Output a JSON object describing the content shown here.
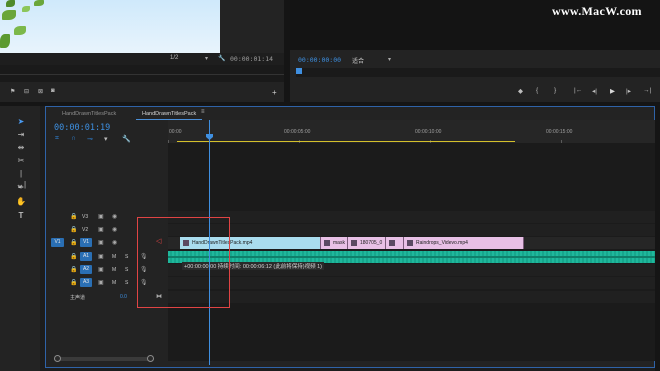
{
  "watermark": "www.MacW.com",
  "source_monitor": {
    "zoom_label": "1/2",
    "timecode": "00:00:01:14"
  },
  "program_monitor": {
    "timecode": "00:00:00:00",
    "fit_label": "适合",
    "transport_icons": [
      "marker-icon",
      "mark-in-icon",
      "mark-out-icon",
      "go-to-in-icon",
      "step-back-icon",
      "play-icon",
      "step-forward-icon",
      "go-to-out-icon"
    ]
  },
  "timeline": {
    "tabs": [
      {
        "label": "HandDrawnTitlesPack"
      },
      {
        "label": "HandDrawnTitlesPack"
      }
    ],
    "playhead_time": "00:00:01:19",
    "ruler_labels": [
      "00:00",
      "00:00:05:00",
      "00:00:10:00",
      "00:00:15:00"
    ],
    "tracks": [
      {
        "name": "V3"
      },
      {
        "name": "V2"
      },
      {
        "name": "V1",
        "source": "V1"
      },
      {
        "name": "A1"
      },
      {
        "name": "A2"
      },
      {
        "name": "A3"
      }
    ],
    "mute_label": "M",
    "solo_label": "S",
    "master": {
      "label": "主声道",
      "value": "0.0"
    },
    "clips": [
      {
        "label": "HandDrawnTitlesPack.mp4"
      },
      {
        "label": "mask"
      },
      {
        "label": "180705_0"
      },
      {
        "label": ""
      },
      {
        "label": "Raindrops_Videvo.mp4"
      }
    ],
    "tooltip": "+00:00:00:00 持续时间: 00:00:06:12 (此前将保持)视频 1)"
  },
  "colors": {
    "accent_blue": "#3d8fe0",
    "clip_video": "#a9dcee",
    "clip_pink": "#e8c0e6",
    "clip_audio": "#1fb89c",
    "highlight": "#e04444",
    "work_area": "#d4c02b"
  }
}
